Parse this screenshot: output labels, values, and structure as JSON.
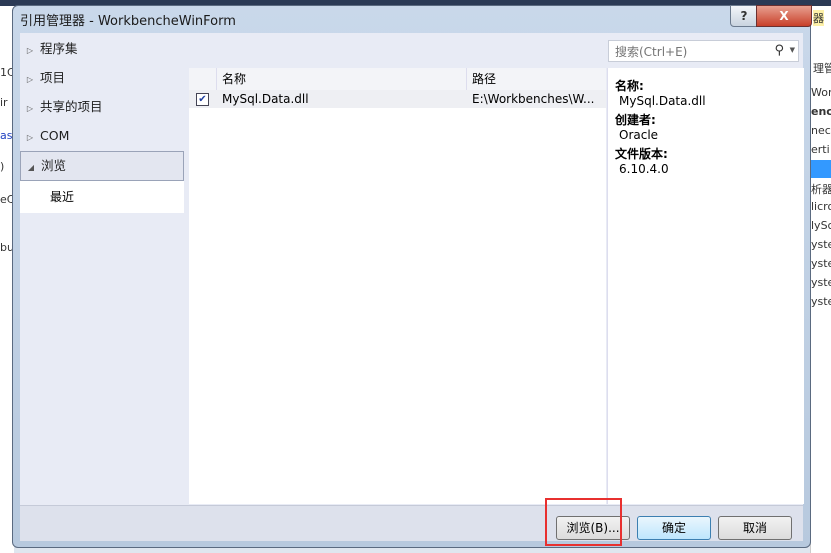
{
  "window": {
    "title": "引用管理器 - WorkbencheWinForm",
    "help_label": "?",
    "close_label": "X"
  },
  "background": {
    "left_fragments": [
      "1C",
      "ir",
      "as",
      ")",
      "eC",
      "bu"
    ],
    "right_fragments": [
      "器",
      "理管",
      "Wor",
      "encl",
      "nect",
      "erti",
      "析器",
      "licro",
      "lySc",
      "yste",
      "yste",
      "yste",
      "yste"
    ]
  },
  "nav": {
    "items": [
      {
        "label": "程序集",
        "expanded": false
      },
      {
        "label": "项目",
        "expanded": false
      },
      {
        "label": "共享的项目",
        "expanded": false
      },
      {
        "label": "COM",
        "expanded": false
      },
      {
        "label": "浏览",
        "expanded": true,
        "selected": true
      }
    ],
    "sub_items": [
      "最近"
    ]
  },
  "search": {
    "placeholder": "搜索(Ctrl+E)"
  },
  "list": {
    "columns": [
      "名称",
      "路径"
    ],
    "rows": [
      {
        "checked": true,
        "name": "MySql.Data.dll",
        "path": "E:\\Workbenches\\W..."
      }
    ]
  },
  "details": {
    "name_label": "名称:",
    "name": "MySql.Data.dll",
    "creator_label": "创建者:",
    "creator": "Oracle",
    "version_label": "文件版本:",
    "version": "6.10.4.0"
  },
  "buttons": {
    "browse": "浏览(B)...",
    "ok": "确定",
    "cancel": "取消"
  },
  "colors": {
    "highlight_box": "#e8302f",
    "close_button": "#c8402a"
  }
}
